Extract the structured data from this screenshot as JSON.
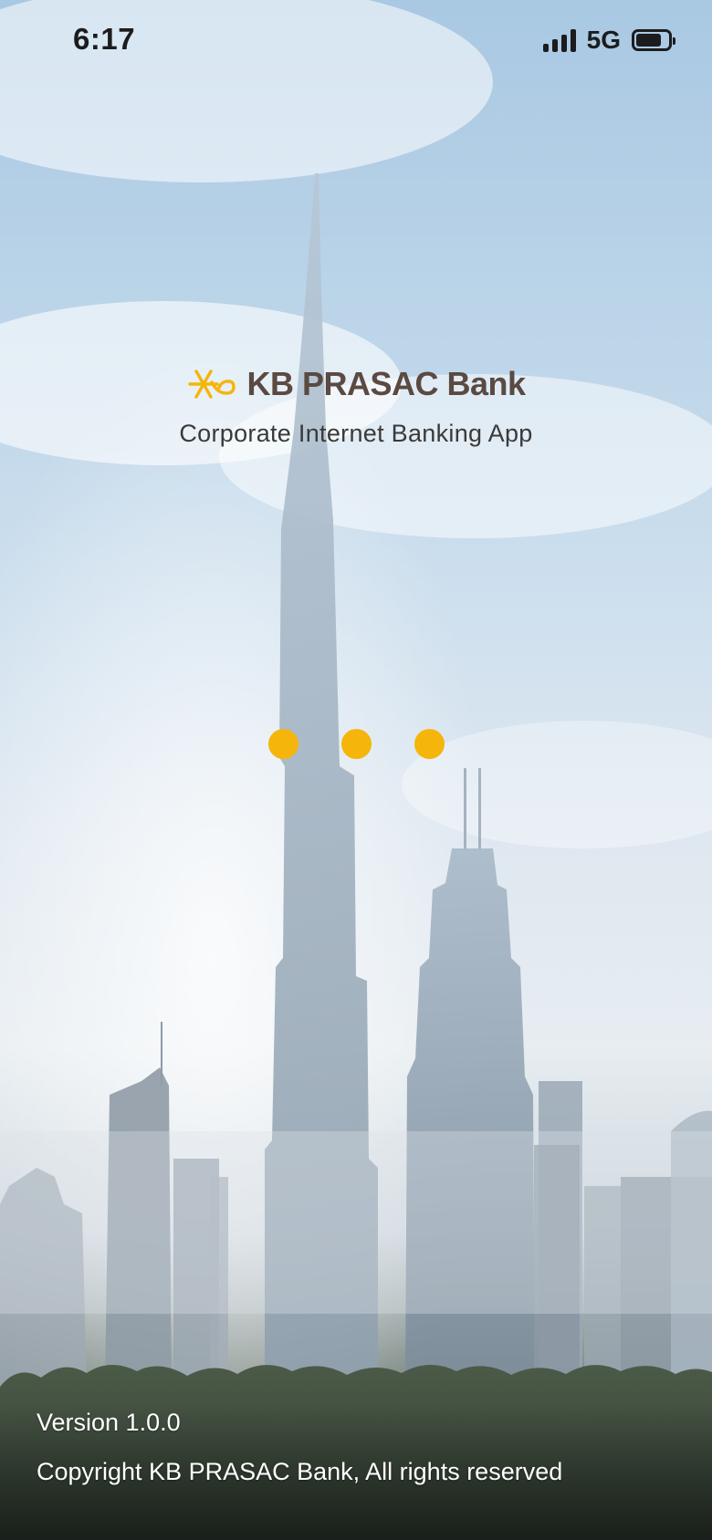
{
  "status_bar": {
    "time": "6:17",
    "network": "5G",
    "signal_bars": 4,
    "battery_level": 0.8,
    "icons": [
      "signal-icon",
      "battery-icon"
    ]
  },
  "brand": {
    "name": "KB PRASAC Bank",
    "subtitle": "Corporate Internet Banking App",
    "logo_icon": "kb-star-logo-icon"
  },
  "loading": {
    "dot_count": 3
  },
  "footer": {
    "version": "Version 1.0.0",
    "copyright": "Copyright KB PRASAC Bank, All rights reserved"
  },
  "colors": {
    "accent": "#F5B50A",
    "brand_text": "#5A4A42",
    "subtitle_text": "#3A3A3A",
    "footer_text": "#FFFFFF"
  }
}
